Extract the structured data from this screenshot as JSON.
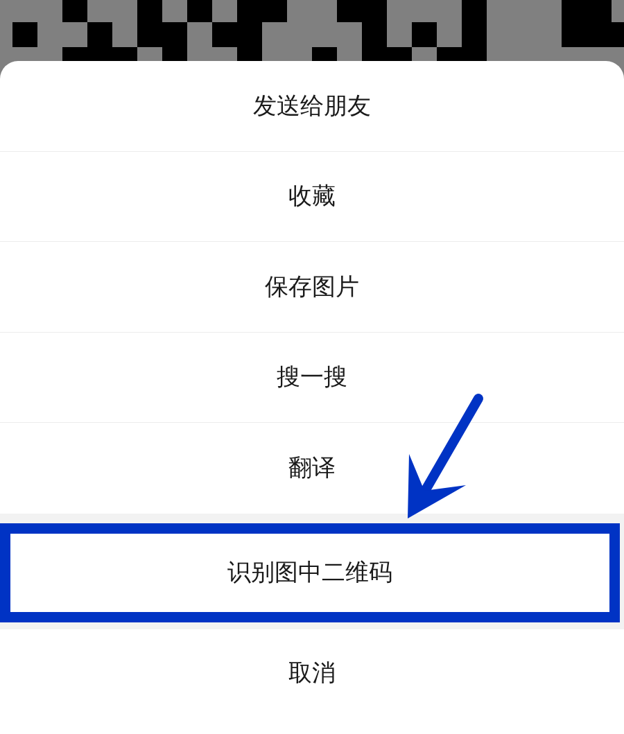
{
  "menu": {
    "items": [
      {
        "label": "发送给朋友",
        "highlighted": false
      },
      {
        "label": "收藏",
        "highlighted": false
      },
      {
        "label": "保存图片",
        "highlighted": false
      },
      {
        "label": "搜一搜",
        "highlighted": false
      },
      {
        "label": "翻译",
        "highlighted": false
      },
      {
        "label": "识别图中二维码",
        "highlighted": true
      }
    ],
    "cancel": "取消"
  }
}
